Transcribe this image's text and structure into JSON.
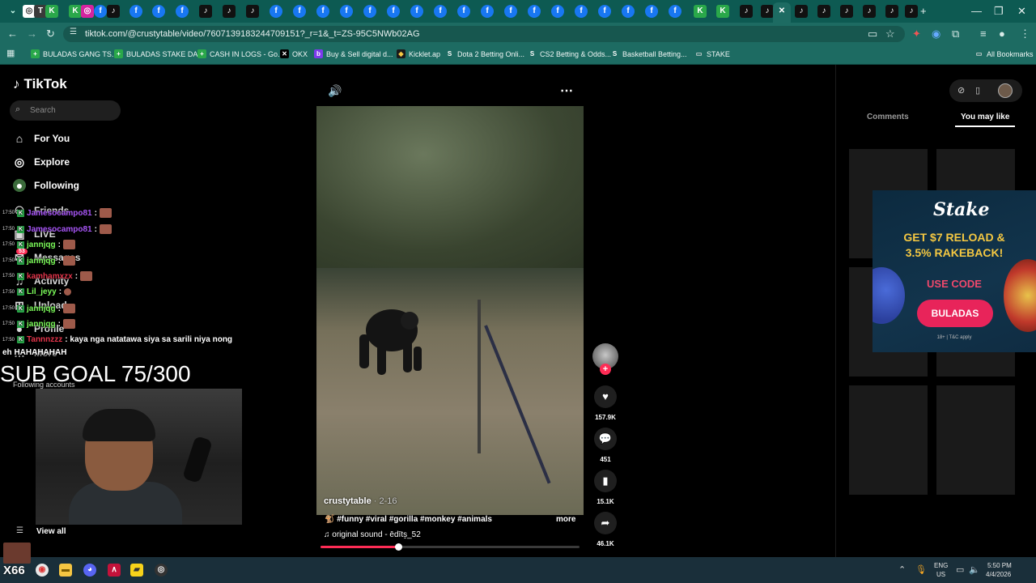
{
  "browser": {
    "url": "tiktok.com/@crustytable/video/7607139183244709151?_r=1&_t=ZS-95C5NWb02AG",
    "bookmarks": [
      {
        "label": "BULADAS GANG TS...",
        "icon": "plus-doc-icon"
      },
      {
        "label": "BULADAS STAKE DA...",
        "icon": "plus-doc-icon"
      },
      {
        "label": "CASH IN LOGS - Go...",
        "icon": "plus-doc-icon"
      },
      {
        "label": "OKX",
        "icon": "okx-icon"
      },
      {
        "label": "Buy & Sell digital d...",
        "icon": "b-icon"
      },
      {
        "label": "Kicklet.ap",
        "icon": "kicklet-icon"
      },
      {
        "label": "Dota 2 Betting Onli...",
        "icon": "stake-icon"
      },
      {
        "label": "CS2 Betting & Odds...",
        "icon": "stake-icon"
      },
      {
        "label": "Basketball Betting...",
        "icon": "stake-icon"
      },
      {
        "label": "STAKE",
        "icon": "folder-icon"
      }
    ],
    "all_bookmarks": "All Bookmarks"
  },
  "sidebar": {
    "logo": "TikTok",
    "search_placeholder": "Search",
    "nav": [
      {
        "label": "For You",
        "icon": "home-icon"
      },
      {
        "label": "Explore",
        "icon": "compass-icon"
      },
      {
        "label": "Following",
        "icon": "following-icon"
      },
      {
        "label": "Friends",
        "icon": "friends-icon"
      },
      {
        "label": "LIVE",
        "icon": "live-icon"
      },
      {
        "label": "Messages",
        "icon": "message-icon"
      },
      {
        "label": "Activity",
        "icon": "bell-icon"
      },
      {
        "label": "Upload",
        "icon": "plus-square-icon"
      },
      {
        "label": "Profile",
        "icon": "profile-icon"
      },
      {
        "label": "More",
        "icon": "more-icon"
      }
    ],
    "messages_badge": "53",
    "following_accounts": "Following accounts",
    "view_all": "View all"
  },
  "chat": {
    "messages": [
      {
        "time": "17:50",
        "user": "Jamesocampo81",
        "text": ":",
        "color": "#a855f7"
      },
      {
        "time": "17:50",
        "user": "Jamesocampo81",
        "text": ":",
        "color": "#a855f7"
      },
      {
        "time": "17:50",
        "user": "jannjqg",
        "text": ":",
        "color": "#7cfc5a"
      },
      {
        "time": "17:50",
        "user": "jannjqg",
        "text": ":",
        "color": "#7cfc5a"
      },
      {
        "time": "17:50",
        "user": "kamhamxzx",
        "text": ":",
        "color": "#e3344a"
      },
      {
        "time": "17:50",
        "user": "Lil_jeyy",
        "text": ":",
        "color": "#7cfc5a"
      },
      {
        "time": "17:50",
        "user": "jannjqg",
        "text": ":",
        "color": "#7cfc5a"
      },
      {
        "time": "17:50",
        "user": "jannjqg",
        "text": ":",
        "color": "#7cfc5a"
      },
      {
        "time": "17:50",
        "user": "Tannnzzz",
        "text": ": kaya nga natatawa siya sa sarili niya nong",
        "color": "#e3344a"
      }
    ],
    "continuation": "eh HAHAHAHAH",
    "sub_goal": "SUB GOAL 75/300"
  },
  "video": {
    "author": "crustytable",
    "date": "· 2-16",
    "hashtags": "🐒 #funny #viral #gorilla #monkey #animals",
    "more": "more",
    "sound": "original sound - ēdīts̱_52",
    "progress": 0.3
  },
  "actions": {
    "likes": "157.9K",
    "comments": "451",
    "saves": "15.1K",
    "shares": "46.1K"
  },
  "right_panel": {
    "tab_comments": "Comments",
    "tab_you_may_like": "You may like",
    "ad": {
      "brand": "Stake",
      "headline1": "GET $7 RELOAD &",
      "headline2": "3.5% RAKEBACK!",
      "code_label": "USE CODE",
      "code": "BULADAS",
      "fine_print": "18+ | T&C apply"
    }
  },
  "taskbar": {
    "badge": "X66",
    "lang1": "ENG",
    "lang2": "US",
    "time": "5:50 PM",
    "date": "4/4/2026"
  },
  "colors": {
    "accent_pink": "#fe2c55",
    "browser_teal": "#1d6b62",
    "ad_gold": "#f5c842"
  }
}
